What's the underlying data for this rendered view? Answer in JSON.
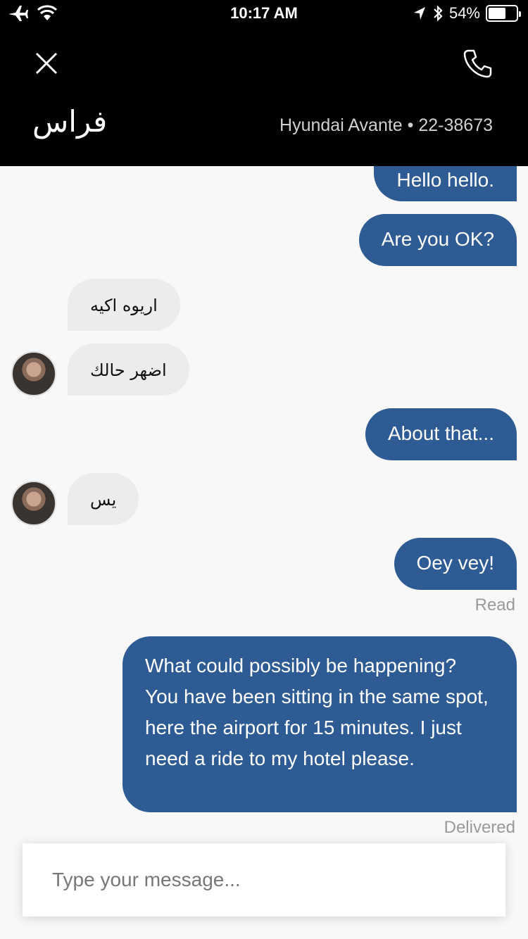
{
  "status_bar": {
    "time": "10:17 AM",
    "battery": "54%"
  },
  "header": {
    "driver_name": "فراس",
    "car_info": "Hyundai Avante • 22-38673",
    "close_icon": "close-icon",
    "call_icon": "phone-icon"
  },
  "messages": [
    {
      "from": "me",
      "text": "Hello hello."
    },
    {
      "from": "me",
      "text": "Are you OK?"
    },
    {
      "from": "driver",
      "text": "اريوه اكيه"
    },
    {
      "from": "driver",
      "text": "اضهر حالك"
    },
    {
      "from": "me",
      "text": "About that..."
    },
    {
      "from": "driver",
      "text": "يس"
    },
    {
      "from": "me",
      "text": "Oey vey!"
    },
    {
      "from": "me",
      "text": "What could possibly be happening? You have been sitting in the same spot, here the airport for 15 minutes. I just need a ride to my hotel please."
    }
  ],
  "receipts": {
    "read": "Read",
    "delivered": "Delivered"
  },
  "composer": {
    "placeholder": "Type your message..."
  },
  "colors": {
    "outgoing_bubble": "#2e5b94",
    "incoming_bubble": "#ececec",
    "header_bg": "#000000"
  }
}
